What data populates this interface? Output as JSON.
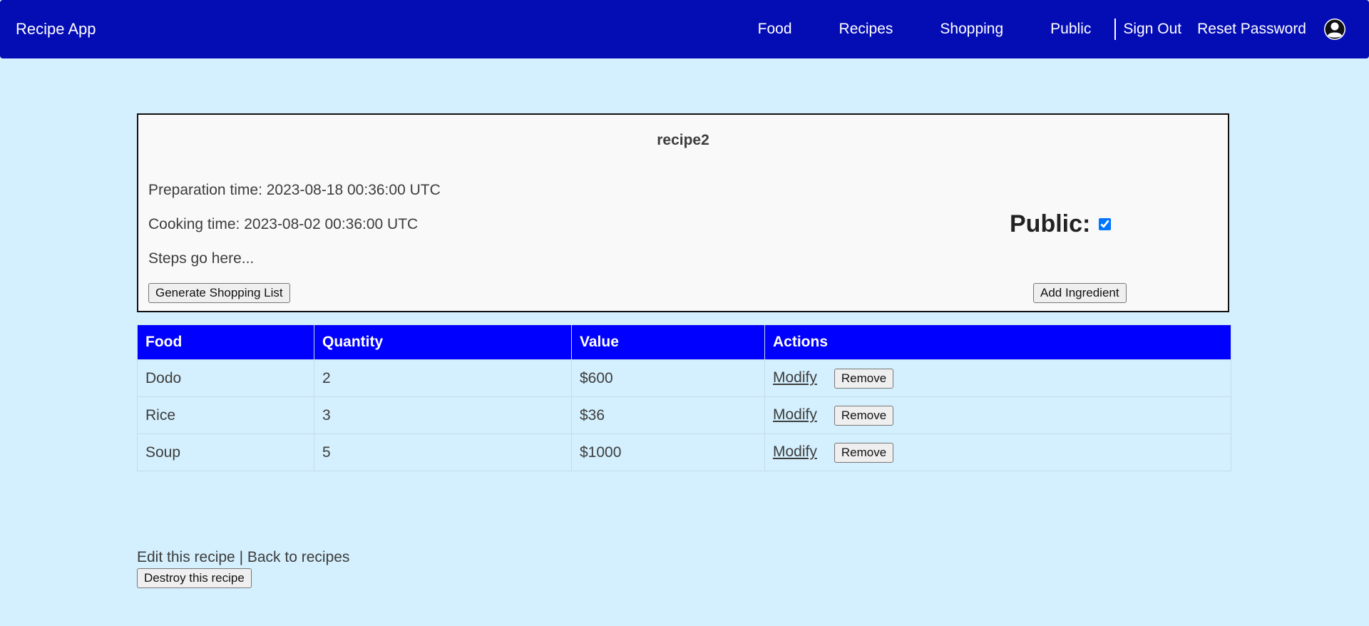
{
  "navbar": {
    "brand": "Recipe App",
    "links": [
      "Food",
      "Recipes",
      "Shopping",
      "Public"
    ],
    "sign_out": "Sign Out",
    "reset_password": "Reset Password",
    "avatar_icon": "user-avatar-icon",
    "background_color": "#040cb4"
  },
  "recipe": {
    "name": "recipe2",
    "preparation_time": "Preparation time: 2023-08-18 00:36:00 UTC",
    "cooking_time": "Cooking time: 2023-08-02 00:36:00 UTC",
    "steps": "Steps go here...",
    "public_label": "Public:",
    "is_public": true,
    "generate_shopping_list_label": "Generate Shopping List",
    "add_ingredient_label": "Add Ingredient"
  },
  "ingredients": {
    "header_color": "#0000fe",
    "headers": [
      "Food",
      "Quantity",
      "Value",
      "Actions"
    ],
    "rows": [
      {
        "food": "Dodo",
        "quantity": "2",
        "value": "$600",
        "modify": "Modify",
        "remove": "Remove"
      },
      {
        "food": "Rice",
        "quantity": "3",
        "value": "$36",
        "modify": "Modify",
        "remove": "Remove"
      },
      {
        "food": "Soup",
        "quantity": "5",
        "value": "$1000",
        "modify": "Modify",
        "remove": "Remove"
      }
    ]
  },
  "footer": {
    "edit_recipe": "Edit this recipe",
    "separator": " | ",
    "back_to_recipes": "Back to recipes",
    "destroy_label": "Destroy this recipe"
  }
}
